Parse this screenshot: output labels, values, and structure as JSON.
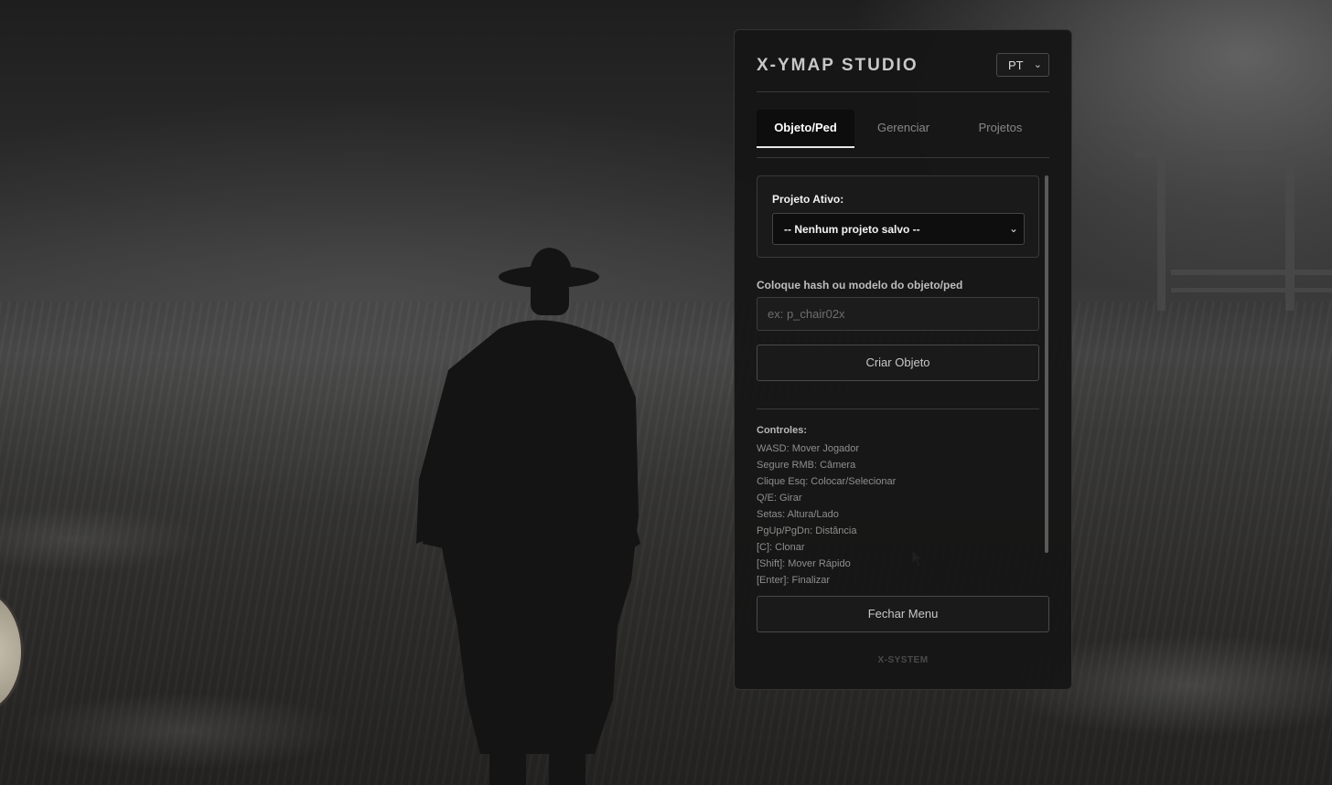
{
  "panel": {
    "title": "X-YMAP STUDIO",
    "language": {
      "selected": "PT"
    },
    "tabs": [
      {
        "label": "Objeto/Ped",
        "active": true
      },
      {
        "label": "Gerenciar",
        "active": false
      },
      {
        "label": "Projetos",
        "active": false
      }
    ],
    "active_project": {
      "label": "Projeto Ativo:",
      "selected": "-- Nenhum projeto salvo --"
    },
    "hash_input": {
      "label": "Coloque hash ou modelo do objeto/ped",
      "placeholder": "ex: p_chair02x",
      "value": ""
    },
    "create_button": "Criar Objeto",
    "controls": {
      "title": "Controles:",
      "items": [
        "WASD: Mover Jogador",
        "Segure RMB: Câmera",
        "Clique Esq: Colocar/Selecionar",
        "Q/E: Girar",
        "Setas: Altura/Lado",
        "PgUp/PgDn: Distância",
        "[C]: Clonar",
        "[Shift]: Mover Rápido",
        "[Enter]: Finalizar"
      ]
    },
    "close_button": "Fechar Menu",
    "footer": "X-SYSTEM"
  },
  "colors": {
    "panel_bg": "#161616",
    "accent": "#e6e6e6"
  }
}
